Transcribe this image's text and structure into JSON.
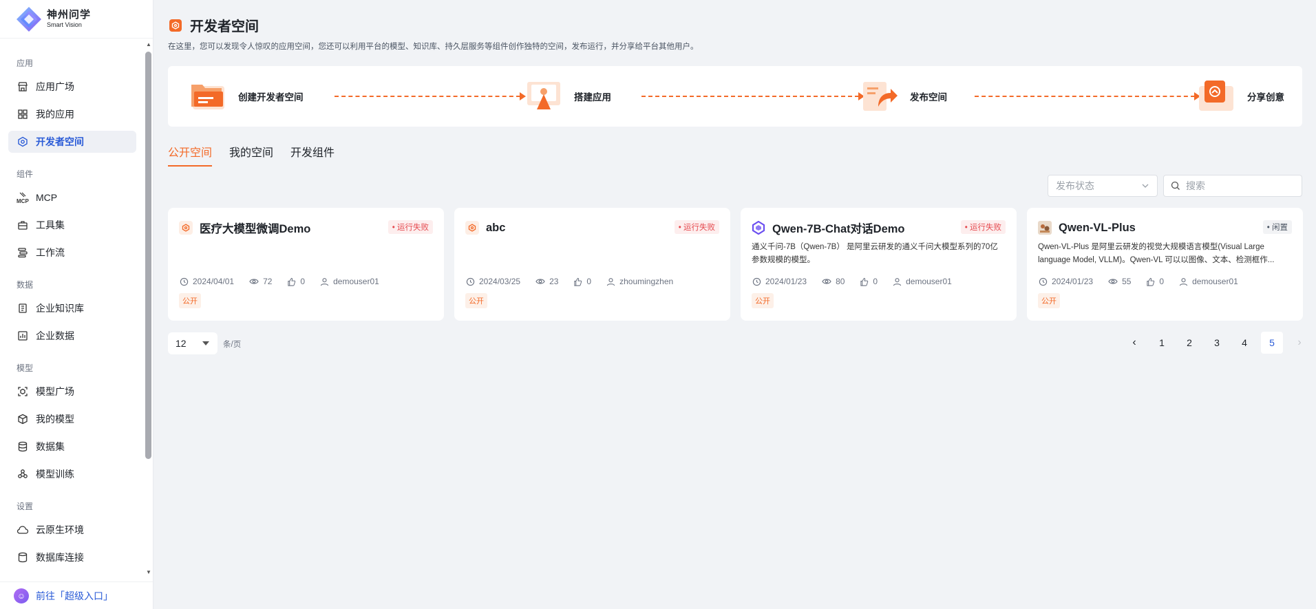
{
  "brand": {
    "name_cn": "神州问学",
    "name_en": "Smart Vision"
  },
  "sidebar": {
    "groups": [
      {
        "label": "应用",
        "items": [
          {
            "label": "应用广场",
            "icon": "store-icon"
          },
          {
            "label": "我的应用",
            "icon": "grid-icon"
          },
          {
            "label": "开发者空间",
            "icon": "hexagon-gear-icon",
            "active": true
          }
        ]
      },
      {
        "label": "组件",
        "items": [
          {
            "label": "MCP",
            "icon": "mcp-icon"
          },
          {
            "label": "工具集",
            "icon": "toolbox-icon"
          },
          {
            "label": "工作流",
            "icon": "workflow-icon"
          }
        ]
      },
      {
        "label": "数据",
        "items": [
          {
            "label": "企业知识库",
            "icon": "book-icon"
          },
          {
            "label": "企业数据",
            "icon": "bar-chart-icon"
          }
        ]
      },
      {
        "label": "模型",
        "items": [
          {
            "label": "模型广场",
            "icon": "model-scan-icon"
          },
          {
            "label": "我的模型",
            "icon": "cube-icon"
          },
          {
            "label": "数据集",
            "icon": "database-icon"
          },
          {
            "label": "模型训练",
            "icon": "training-icon"
          }
        ]
      },
      {
        "label": "设置",
        "items": [
          {
            "label": "云原生环境",
            "icon": "cloud-icon"
          },
          {
            "label": "数据库连接",
            "icon": "db-connect-icon"
          }
        ]
      }
    ],
    "bottom_link": "前往「超级入口」"
  },
  "page": {
    "title": "开发者空间",
    "subtitle": "在这里，您可以发现令人惊叹的应用空间，您还可以利用平台的模型、知识库、持久层服务等组件创作独特的空间，发布运行，并分享给平台其他用户。"
  },
  "steps": [
    {
      "label": "创建开发者空间",
      "icon": "folder-icon"
    },
    {
      "label": "搭建应用",
      "icon": "build-app-icon"
    },
    {
      "label": "发布空间",
      "icon": "publish-icon"
    },
    {
      "label": "分享创意",
      "icon": "share-icon"
    }
  ],
  "tabs": [
    {
      "label": "公开空间",
      "active": true
    },
    {
      "label": "我的空间"
    },
    {
      "label": "开发组件"
    }
  ],
  "filters": {
    "status_placeholder": "发布状态",
    "search_placeholder": "搜索"
  },
  "cards": [
    {
      "title": "医疗大模型微调Demo",
      "status": "运行失败",
      "status_type": "fail",
      "desc": "",
      "date": "2024/04/01",
      "views": "72",
      "likes": "0",
      "user": "demouser01",
      "tag": "公开",
      "icon": "hexagon-gear-icon"
    },
    {
      "title": "abc",
      "status": "运行失败",
      "status_type": "fail",
      "desc": "",
      "date": "2024/03/25",
      "views": "23",
      "likes": "0",
      "user": "zhoumingzhen",
      "tag": "公开",
      "icon": "hexagon-gear-icon"
    },
    {
      "title": "Qwen-7B-Chat对话Demo",
      "status": "运行失败",
      "status_type": "fail",
      "desc": "通义千问-7B（Qwen-7B） 是阿里云研发的通义千问大模型系列的70亿参数规模的模型。",
      "date": "2024/01/23",
      "views": "80",
      "likes": "0",
      "user": "demouser01",
      "tag": "公开",
      "icon": "qwen-logo-icon"
    },
    {
      "title": "Qwen-VL-Plus",
      "status": "闲置",
      "status_type": "idle",
      "desc": "Qwen-VL-Plus 是阿里云研发的视觉大规模语言模型(Visual Large language Model, VLLM)。Qwen-VL 可以以图像、文本、检测框作...",
      "date": "2024/01/23",
      "views": "55",
      "likes": "0",
      "user": "demouser01",
      "tag": "公开",
      "icon": "image-avatar-icon"
    }
  ],
  "pagination": {
    "page_size": "12",
    "unit": "条/页",
    "pages": [
      "1",
      "2",
      "3",
      "4",
      "5"
    ],
    "current": "5"
  },
  "colors": {
    "accent": "#f36a28",
    "primary": "#2a5bd7",
    "fail": "#e5484d"
  }
}
